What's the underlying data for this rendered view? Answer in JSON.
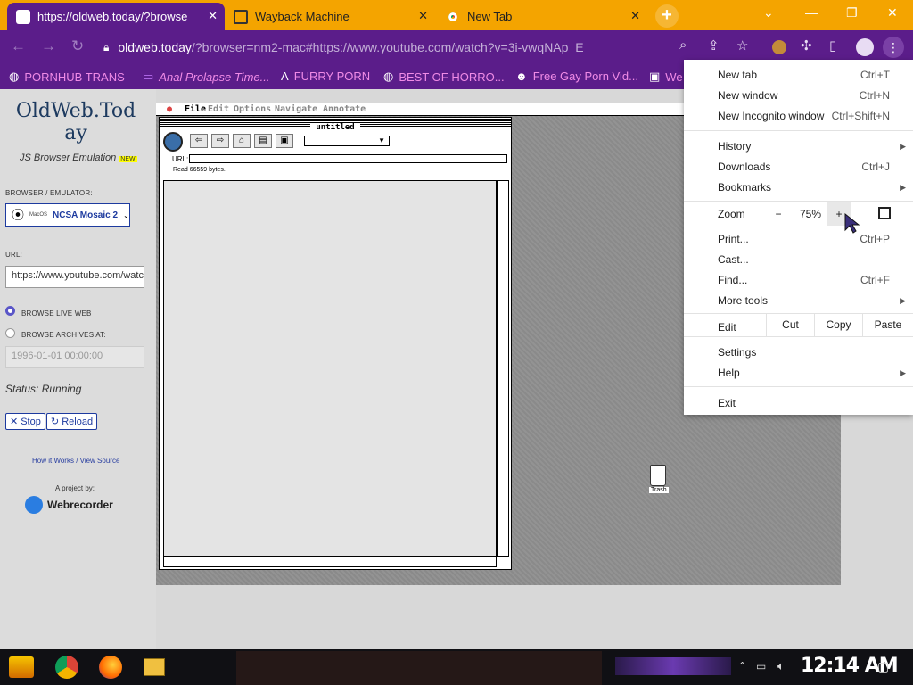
{
  "browser_tabs": [
    {
      "title": "https://oldweb.today/?browse",
      "icon": "oldweb-favicon-icon"
    },
    {
      "title": "Wayback Machine",
      "icon": "archive-building-icon"
    },
    {
      "title": "New Tab",
      "icon": "chrome-icon"
    }
  ],
  "toolbar": {
    "url_host": "oldweb.today",
    "url_rest": "/?browser=nm2-mac#https://www.youtube.com/watch?v=3i-vwqNAp_E"
  },
  "bookmarks": [
    {
      "label": "PORNHUB TRANS",
      "icon": "globe-icon"
    },
    {
      "label": "Anal Prolapse Time...",
      "icon": "bookmark-icon"
    },
    {
      "label": "FURRY PORN",
      "icon": "bookmark-icon"
    },
    {
      "label": "BEST OF HORRO...",
      "icon": "globe-icon"
    },
    {
      "label": "Free Gay Porn Vid...",
      "icon": "bookmark-icon"
    },
    {
      "label": "We",
      "icon": "bookmark-icon"
    }
  ],
  "leftpanel": {
    "logo_line1": "OldWeb.Tod",
    "logo_line2": "ay",
    "tagline": "JS Browser Emulation",
    "new_badge": "NEW",
    "browser_label": "BROWSER / EMULATOR:",
    "browser_os": "MacOS",
    "browser_name": "NCSA Mosaic 2",
    "url_label": "URL:",
    "url_value": "https://www.youtube.com/watc",
    "live_label": "BROWSE LIVE WEB",
    "archive_label": "BROWSE ARCHIVES AT:",
    "archive_date": "1996-01-01 00:00:00",
    "status": "Status: Running",
    "stop": "Stop",
    "reload": "Reload",
    "links": "How it Works / View Source",
    "project_by": "A project by:",
    "webrecorder": "Webrecorder"
  },
  "emulator": {
    "menus": [
      "File",
      "Edit",
      "Options",
      "Navigate",
      "Annotate"
    ],
    "window_title": "untitled",
    "url_label": "URL:",
    "status_line": "Read 66559 bytes.",
    "trash_label": "Trash"
  },
  "chrome_menu": {
    "new_tab": "New tab",
    "new_tab_sc": "Ctrl+T",
    "new_window": "New window",
    "new_window_sc": "Ctrl+N",
    "incognito": "New Incognito window",
    "incognito_sc": "Ctrl+Shift+N",
    "history": "History",
    "downloads": "Downloads",
    "downloads_sc": "Ctrl+J",
    "bookmarks": "Bookmarks",
    "zoom": "Zoom",
    "zoom_minus": "−",
    "zoom_value": "75%",
    "zoom_plus": "+",
    "print": "Print...",
    "print_sc": "Ctrl+P",
    "cast": "Cast...",
    "find": "Find...",
    "find_sc": "Ctrl+F",
    "more_tools": "More tools",
    "edit": "Edit",
    "cut": "Cut",
    "copy": "Copy",
    "paste": "Paste",
    "settings": "Settings",
    "help": "Help",
    "exit": "Exit"
  },
  "taskbar": {
    "time": "12:14 AM"
  },
  "colors": {
    "tab_strip": "#f4a400",
    "toolbar": "#5b1d8a",
    "bookmark_text": "#f08be6",
    "logo": "#1d3a5f"
  }
}
